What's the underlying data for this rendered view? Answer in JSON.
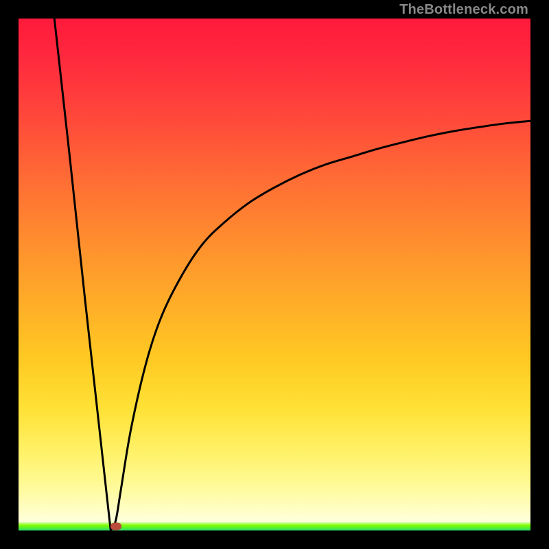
{
  "attribution": "TheBottleneck.com",
  "colors": {
    "border": "#000000",
    "curve": "#000000",
    "marker": "#bb4b3c",
    "gradient_top": "#ff1a3b",
    "gradient_bottom": "#ffffe8",
    "green_band": "#28e070"
  },
  "chart_data": {
    "type": "line",
    "title": "",
    "xlabel": "",
    "ylabel": "",
    "xlim": [
      0,
      100
    ],
    "ylim": [
      0,
      100
    ],
    "grid": false,
    "legend": false,
    "comment": "V-shaped bottleneck curve. Left branch is a steep straight line dropping from ~(7,100) to the minimum at ~(18,0). Right branch rises from the minimum toward the upper-right, decelerating (concave down) and ending near (100,80). y≈0 indicates optimal balance (green band).",
    "series": [
      {
        "name": "bottleneck-curve",
        "x": [
          7,
          10,
          13,
          16,
          17,
          18,
          19,
          20,
          22,
          25,
          28,
          32,
          36,
          40,
          45,
          50,
          55,
          60,
          65,
          70,
          75,
          80,
          85,
          90,
          95,
          100
        ],
        "y": [
          100,
          73,
          45,
          18,
          9,
          0,
          2,
          8,
          20,
          33,
          42,
          50,
          56,
          60,
          64,
          67,
          69.5,
          71.5,
          73,
          74.5,
          75.8,
          77,
          78,
          78.8,
          79.5,
          80
        ]
      }
    ],
    "marker": {
      "x": 19,
      "y": 0.8
    }
  }
}
